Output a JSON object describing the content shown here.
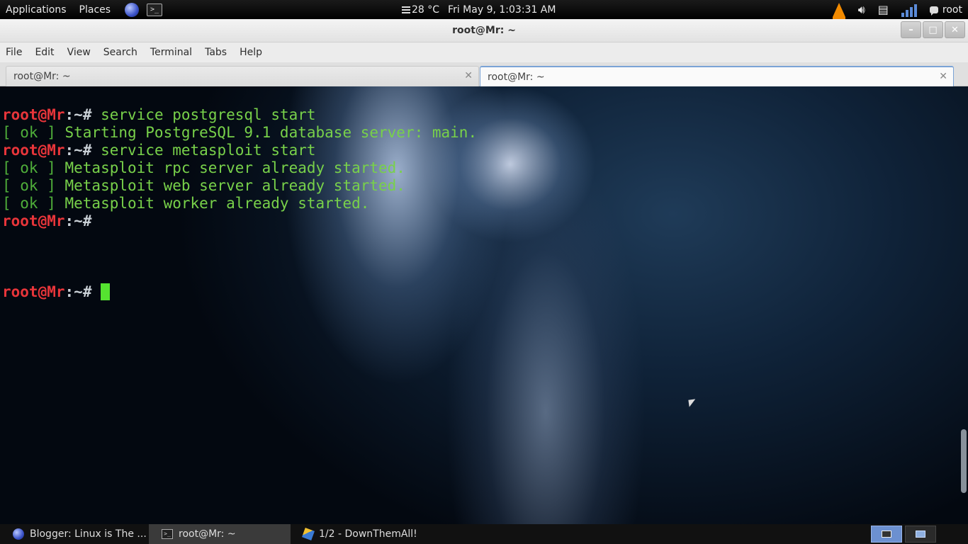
{
  "top_panel": {
    "applications": "Applications",
    "places": "Places",
    "weather": "28 °C",
    "clock": "Fri May  9,  1:03:31 AM",
    "user": "root"
  },
  "window": {
    "title": "root@Mr: ~",
    "buttons": {
      "minimize": "–",
      "maximize": "□",
      "close": "✕"
    }
  },
  "menubar": [
    "File",
    "Edit",
    "View",
    "Search",
    "Terminal",
    "Tabs",
    "Help"
  ],
  "tabs": [
    {
      "label": "root@Mr: ~",
      "active": false
    },
    {
      "label": "root@Mr: ~",
      "active": true
    }
  ],
  "terminal": {
    "prompt_user": "root@Mr",
    "prompt_sep": ":",
    "prompt_path": "~#",
    "lines": [
      {
        "type": "prompt",
        "command": " service postgresql start"
      },
      {
        "type": "ok",
        "status": "[ ok ]",
        "text": " Starting PostgreSQL 9.1 database server: main."
      },
      {
        "type": "prompt",
        "command": " service metasploit start"
      },
      {
        "type": "ok",
        "status": "[ ok ]",
        "text": " Metasploit rpc server already started."
      },
      {
        "type": "ok",
        "status": "[ ok ]",
        "text": " Metasploit web server already started."
      },
      {
        "type": "ok",
        "status": "[ ok ]",
        "text": " Metasploit worker already started."
      },
      {
        "type": "prompt",
        "command": ""
      },
      {
        "type": "prompt",
        "command": " "
      }
    ]
  },
  "taskbar": [
    {
      "label": "Blogger: Linux is The ...",
      "icon": "globe-icon"
    },
    {
      "label": "root@Mr: ~",
      "icon": "terminal-icon",
      "active": true
    },
    {
      "label": "1/2 - DownThemAll!",
      "icon": "download-icon"
    }
  ],
  "colors": {
    "prompt_user": "#e8353a",
    "output_text": "#78d14a",
    "cursor": "#55e330",
    "active_tab_accent": "#7aa3d6"
  }
}
